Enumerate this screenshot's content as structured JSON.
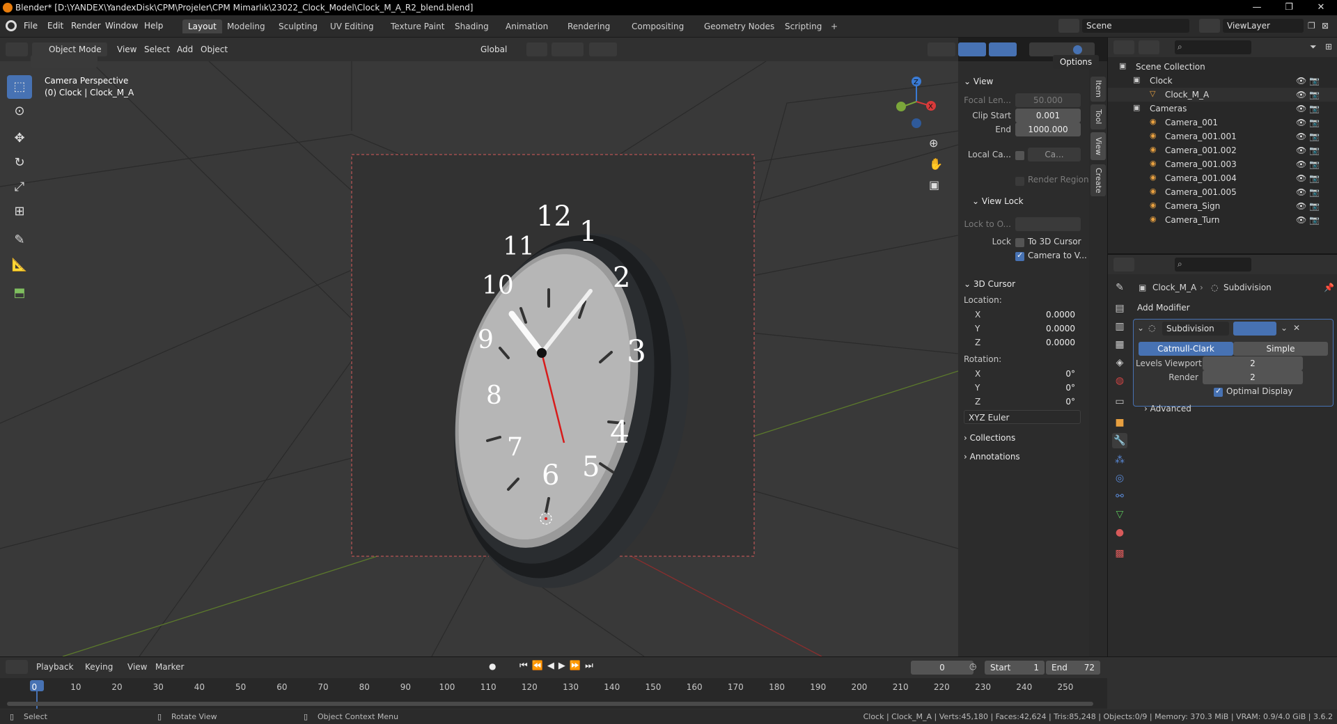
{
  "window": {
    "title": "Blender* [D:\\YANDEX\\YandexDisk\\CPM\\Projeler\\CPM Mimarlık\\23022_Clock_Model\\Clock_M_A_R2_blend.blend]",
    "minimize": "—",
    "maximize": "❐",
    "close": "✕"
  },
  "menu": {
    "items": [
      "File",
      "Edit",
      "Render",
      "Window",
      "Help"
    ]
  },
  "workspaces": [
    "Layout",
    "Modeling",
    "Sculpting",
    "UV Editing",
    "Texture Paint",
    "Shading",
    "Animation",
    "Rendering",
    "Compositing",
    "Geometry Nodes",
    "Scripting",
    "+"
  ],
  "scene": {
    "name": "Scene",
    "view_layer": "ViewLayer"
  },
  "viewport_header": {
    "mode": "Object Mode",
    "menus": [
      "View",
      "Select",
      "Add",
      "Object"
    ],
    "orientation": "Global",
    "options": "Options"
  },
  "viewport": {
    "perspective": "Camera Perspective",
    "info": "(0) Clock | Clock_M_A",
    "clock_numbers": [
      "12",
      "1",
      "2",
      "3",
      "4",
      "5",
      "6",
      "7",
      "8",
      "9",
      "10",
      "11"
    ]
  },
  "npanel": {
    "view": {
      "title": "View",
      "focal_label": "Focal Len...",
      "focal": "50.000",
      "clip_start_label": "Clip Start",
      "clip_start": "0.001",
      "end_label": "End",
      "end": "1000.000",
      "local_label": "Local Ca...",
      "local_val": "Ca...",
      "render_region": "Render Region"
    },
    "view_lock": {
      "title": "View Lock",
      "lock_to": "Lock to O...",
      "lock_label": "Lock",
      "to_cursor": "To 3D Cursor",
      "camera_to_view": "Camera to V..."
    },
    "cursor": {
      "title": "3D Cursor",
      "location_label": "Location:",
      "lx": "0.0000",
      "ly": "0.0000",
      "lz": "0.0000",
      "rotation_label": "Rotation:",
      "rx": "0°",
      "ry": "0°",
      "rz": "0°",
      "mode": "XYZ Euler"
    },
    "collections": "Collections",
    "annotations": "Annotations"
  },
  "sidetabs": [
    "Item",
    "Tool",
    "View",
    "Create"
  ],
  "outliner": {
    "root": "Scene Collection",
    "rows": [
      {
        "label": "Clock",
        "indent": 1
      },
      {
        "label": "Clock_M_A",
        "indent": 2
      },
      {
        "label": "Cameras",
        "indent": 1
      },
      {
        "label": "Camera_001",
        "indent": 2
      },
      {
        "label": "Camera_001.001",
        "indent": 2
      },
      {
        "label": "Camera_001.002",
        "indent": 2
      },
      {
        "label": "Camera_001.003",
        "indent": 2
      },
      {
        "label": "Camera_001.004",
        "indent": 2
      },
      {
        "label": "Camera_001.005",
        "indent": 2
      },
      {
        "label": "Camera_Sign",
        "indent": 2
      },
      {
        "label": "Camera_Turn",
        "indent": 2
      }
    ]
  },
  "properties": {
    "object": "Clock_M_A",
    "modifier_crumb": "Subdivision",
    "add_modifier": "Add Modifier",
    "modifier_name": "Subdivision",
    "catmull": "Catmull-Clark",
    "simple": "Simple",
    "levels_label": "Levels Viewport",
    "levels": "2",
    "render_label": "Render",
    "render": "2",
    "optimal": "Optimal Display",
    "advanced": "Advanced"
  },
  "timeline": {
    "menus": [
      "Playback",
      "Keying",
      "View",
      "Marker"
    ],
    "current": "0",
    "start_label": "Start",
    "start": "1",
    "end_label": "End",
    "end": "72",
    "ticks": [
      "0",
      "10",
      "20",
      "30",
      "40",
      "50",
      "60",
      "70",
      "80",
      "90",
      "100",
      "110",
      "120",
      "130",
      "140",
      "150",
      "160",
      "170",
      "180",
      "190",
      "200",
      "210",
      "220",
      "230",
      "240",
      "250"
    ]
  },
  "status": {
    "select": "Select",
    "rotate": "Rotate View",
    "context": "Object Context Menu",
    "stats": "Clock | Clock_M_A | Verts:45,180 | Faces:42,624 | Tris:85,248 | Objects:0/9 | Memory: 370.3 MiB | VRAM: 0.9/4.0 GiB | 3.6.2"
  },
  "colors": {
    "accent": "#4772b3",
    "orange": "#e87d0d",
    "hand": "#d81b1b"
  }
}
